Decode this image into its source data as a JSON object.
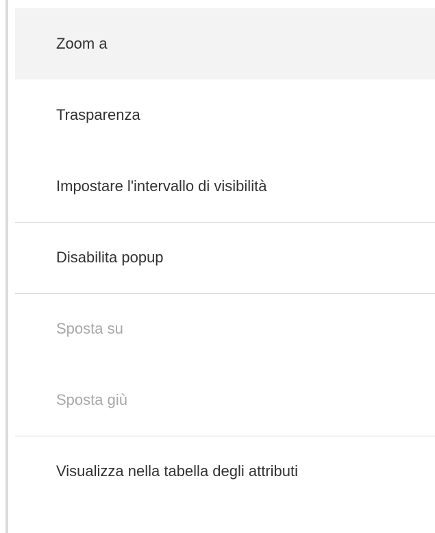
{
  "menu": {
    "items": [
      {
        "label": "Zoom a",
        "state": "hover"
      },
      {
        "label": "Trasparenza",
        "state": "normal"
      },
      {
        "label": "Impostare l'intervallo di visibilità",
        "state": "normal"
      },
      {
        "label": "Disabilita popup",
        "state": "normal"
      },
      {
        "label": "Sposta su",
        "state": "disabled"
      },
      {
        "label": "Sposta giù",
        "state": "disabled"
      },
      {
        "label": "Visualizza nella tabella degli attributi",
        "state": "normal"
      }
    ]
  },
  "colors": {
    "text": "#323232",
    "disabled_text": "#a8a8a8",
    "hover_background": "#f3f3f3",
    "divider": "#dadada"
  }
}
